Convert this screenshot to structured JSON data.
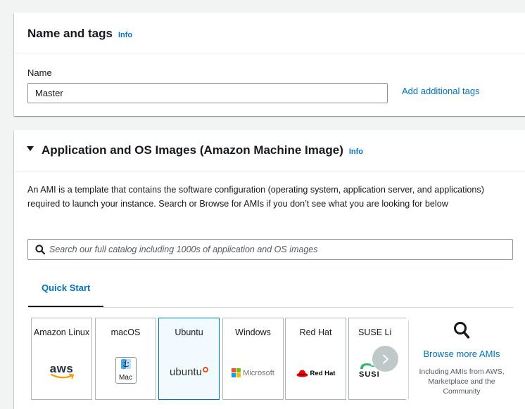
{
  "name_and_tags": {
    "title": "Name and tags",
    "info": "Info",
    "name_label": "Name",
    "name_value": "Master",
    "add_tags": "Add additional tags"
  },
  "ami_section": {
    "title": "Application and OS Images (Amazon Machine Image)",
    "info": "Info",
    "description": "An AMI is a template that contains the software configuration (operating system, application server, and applications) required to launch your instance. Search or Browse for AMIs if you don’t see what you are looking for below",
    "search_placeholder": "Search our full catalog including 1000s of application and OS images",
    "tabs": [
      {
        "label": "Quick Start",
        "active": true
      }
    ],
    "amis": [
      {
        "name": "Amazon Linux",
        "logo_text": "aws",
        "selected": false
      },
      {
        "name": "macOS",
        "logo_text": "Mac",
        "selected": false
      },
      {
        "name": "Ubuntu",
        "logo_text": "ubuntu",
        "selected": true
      },
      {
        "name": "Windows",
        "logo_text": "Microsoft",
        "selected": false
      },
      {
        "name": "Red Hat",
        "logo_text": "Red Hat",
        "selected": false
      },
      {
        "name": "SUSE Li",
        "logo_text": "SUSI",
        "selected": false
      }
    ],
    "browse": {
      "link": "Browse more AMIs",
      "subtext": "Including AMIs from AWS, Marketplace and the Community"
    }
  },
  "colors": {
    "link": "#0073bb",
    "selected_border": "#0073bb",
    "selected_bg": "#f1faff",
    "text": "#16191f"
  }
}
